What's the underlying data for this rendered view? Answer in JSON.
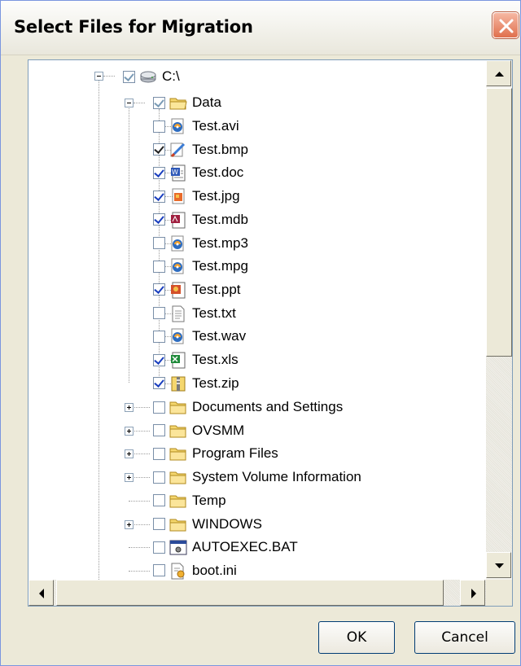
{
  "window": {
    "title": "Select Files for Migration"
  },
  "tree": {
    "root": {
      "label": "C:\\",
      "checked": "partial"
    },
    "data_folder": {
      "label": "Data",
      "checked": "partial"
    },
    "files": [
      {
        "label": "Test.avi",
        "checked": false,
        "icon": "media-file-icon"
      },
      {
        "label": "Test.bmp",
        "checked": true,
        "icon": "paint-file-icon"
      },
      {
        "label": "Test.doc",
        "checked": true,
        "icon": "word-file-icon"
      },
      {
        "label": "Test.jpg",
        "checked": true,
        "icon": "image-file-icon"
      },
      {
        "label": "Test.mdb",
        "checked": true,
        "icon": "access-file-icon"
      },
      {
        "label": "Test.mp3",
        "checked": false,
        "icon": "media-file-icon"
      },
      {
        "label": "Test.mpg",
        "checked": false,
        "icon": "media-file-icon"
      },
      {
        "label": "Test.ppt",
        "checked": true,
        "icon": "powerpoint-file-icon"
      },
      {
        "label": "Test.txt",
        "checked": false,
        "icon": "text-file-icon"
      },
      {
        "label": "Test.wav",
        "checked": false,
        "icon": "media-file-icon"
      },
      {
        "label": "Test.xls",
        "checked": true,
        "icon": "excel-file-icon"
      },
      {
        "label": "Test.zip",
        "checked": true,
        "icon": "zip-file-icon"
      }
    ],
    "siblings": [
      {
        "label": "Documents and Settings",
        "expandable": true,
        "icon": "folder-icon"
      },
      {
        "label": "OVSMM",
        "expandable": true,
        "icon": "folder-icon"
      },
      {
        "label": "Program Files",
        "expandable": true,
        "icon": "folder-icon"
      },
      {
        "label": "System Volume Information",
        "expandable": true,
        "icon": "folder-icon"
      },
      {
        "label": "Temp",
        "expandable": false,
        "icon": "folder-icon"
      },
      {
        "label": "WINDOWS",
        "expandable": true,
        "icon": "folder-icon"
      },
      {
        "label": "AUTOEXEC.BAT",
        "expandable": false,
        "icon": "batch-file-icon"
      },
      {
        "label": "boot.ini",
        "expandable": false,
        "icon": "ini-file-icon"
      }
    ]
  },
  "buttons": {
    "ok": "OK",
    "cancel": "Cancel"
  },
  "colors": {
    "folder": "#f5d76e",
    "checkmark": "#1a3fbf",
    "close": "#e0704d"
  }
}
